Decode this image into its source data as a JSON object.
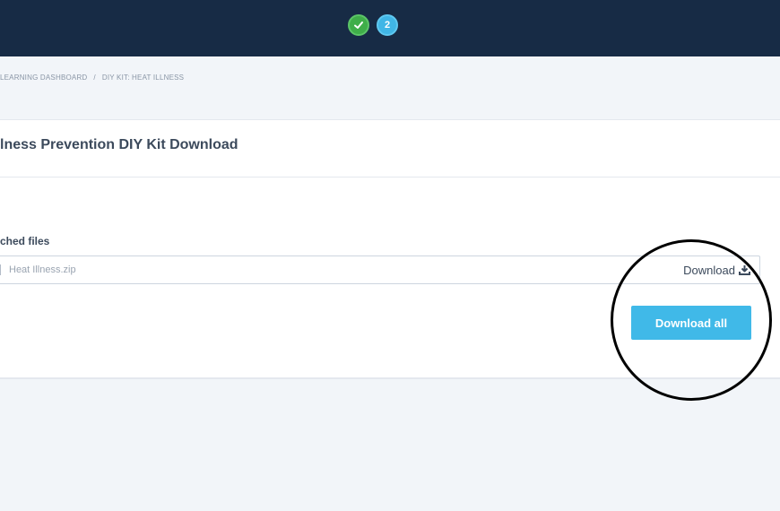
{
  "steps": {
    "current_number": "2"
  },
  "breadcrumb": {
    "items": [
      "LEARNING DASHBOARD",
      "DIY KIT: HEAT ILLNESS"
    ],
    "separator": "/"
  },
  "page": {
    "title": "lness Prevention DIY Kit Download"
  },
  "attachments": {
    "label": "ched files",
    "files": [
      {
        "name": "Heat Illness.zip",
        "action_label": "Download",
        "action_icon": "download-tray-icon"
      }
    ],
    "download_all_label": "Download all"
  },
  "colors": {
    "topbar": "#172b45",
    "step_done": "#3fae49",
    "step_current": "#40b6e6",
    "primary_button": "#40b9e8"
  }
}
